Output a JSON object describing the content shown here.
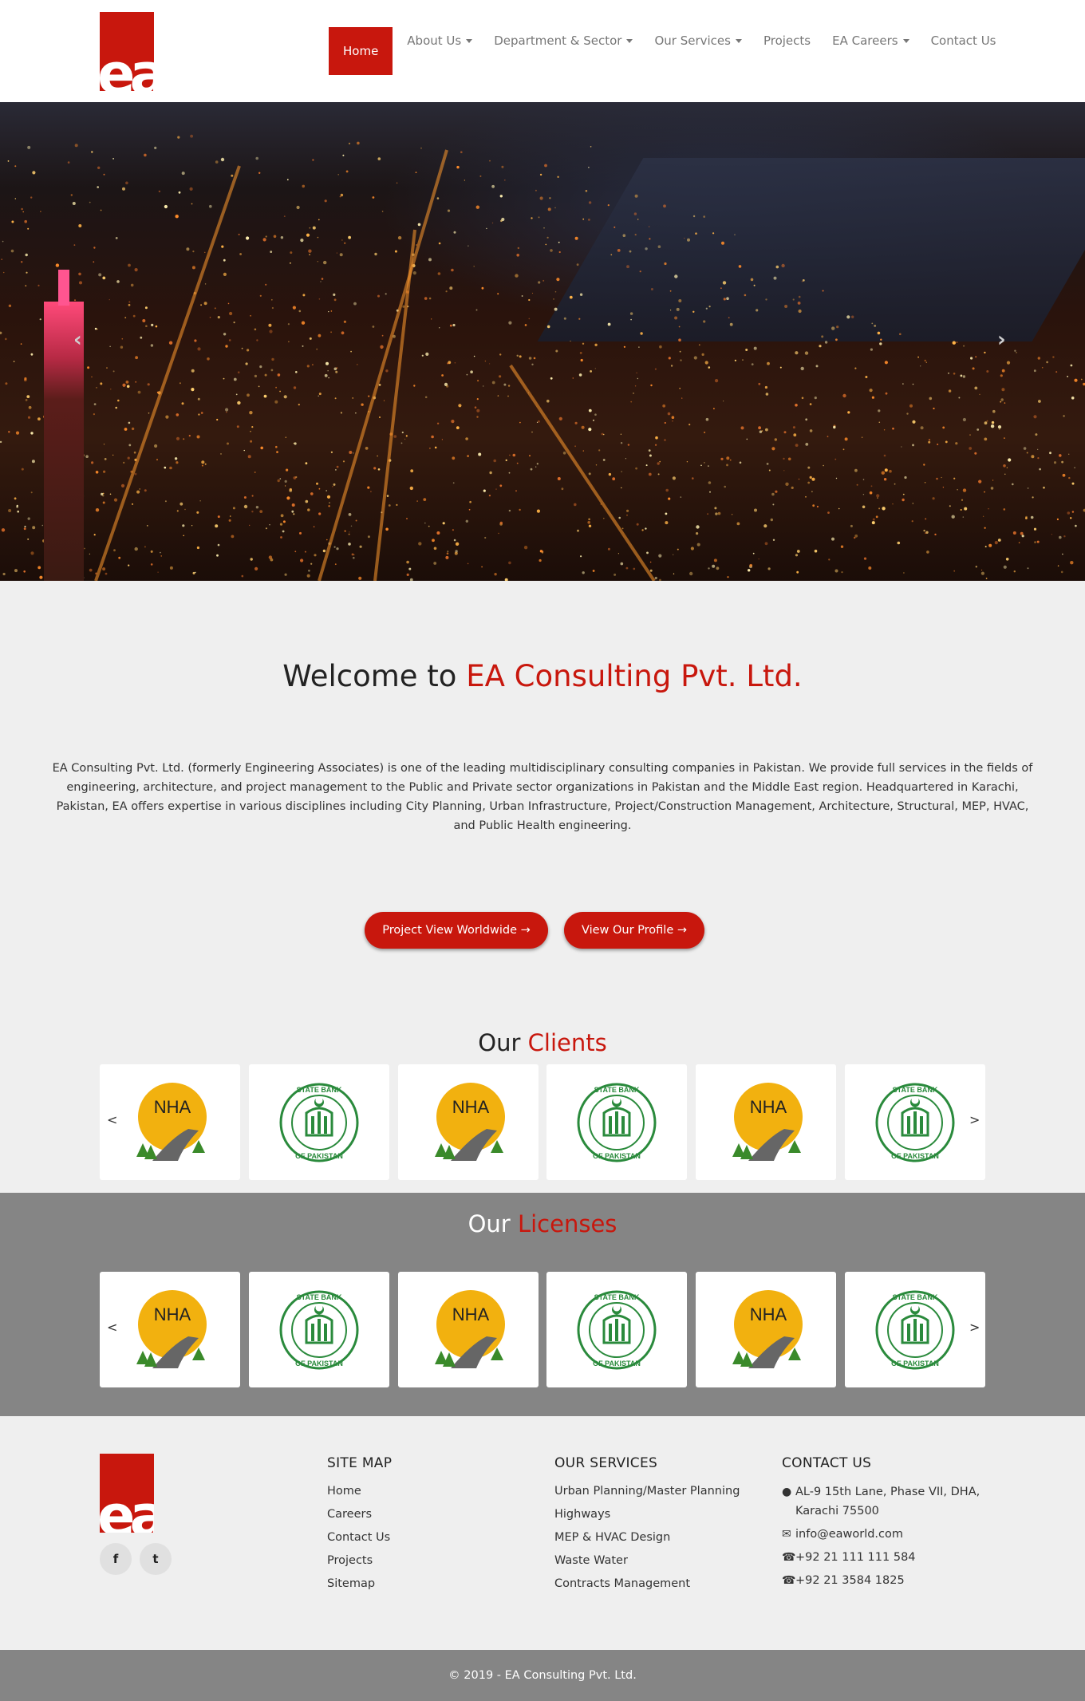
{
  "brand": {
    "logo_text": "ea",
    "color": "#c8170d"
  },
  "nav": {
    "items": [
      {
        "label": "Home",
        "active": true,
        "dropdown": false
      },
      {
        "label": "About Us",
        "dropdown": true
      },
      {
        "label": "Department & Sector",
        "dropdown": true
      },
      {
        "label": "Our Services",
        "dropdown": true
      },
      {
        "label": "Projects",
        "dropdown": false
      },
      {
        "label": "EA Careers",
        "dropdown": true
      },
      {
        "label": "Contact Us",
        "dropdown": false
      }
    ]
  },
  "hero": {
    "prev_label": "‹",
    "next_label": "›"
  },
  "welcome": {
    "title_prefix": "Welcome to ",
    "title_highlight": "EA Consulting Pvt. Ltd.",
    "text": "EA Consulting Pvt. Ltd. (formerly Engineering Associates) is one of the leading multidisciplinary consulting companies in Pakistan. We provide full services in the fields of engineering, architecture, and project management to the Public and Private sector organizations in Pakistan and the Middle East region. Headquartered in Karachi, Pakistan, EA offers expertise in various disciplines including City Planning, Urban Infrastructure, Project/Construction Management, Architecture, Structural, MEP, HVAC, and Public Health engineering.",
    "btn_projects": "Project View Worldwide →",
    "btn_profile": "View Our Profile →"
  },
  "clients": {
    "title_prefix": "Our ",
    "title_highlight": "Clients",
    "prev": "<",
    "next": ">",
    "logos": [
      "NHA",
      "State Bank of Pakistan",
      "NHA",
      "State Bank of Pakistan",
      "NHA",
      "State Bank of Pakistan"
    ]
  },
  "licenses": {
    "title_prefix": "Our ",
    "title_highlight": "Licenses",
    "prev": "<",
    "next": ">",
    "logos": [
      "NHA",
      "State Bank of Pakistan",
      "NHA",
      "State Bank of Pakistan",
      "NHA",
      "State Bank of Pakistan"
    ]
  },
  "logo_text": {
    "nha": "NHA",
    "sbp_top": "STATE BANK",
    "sbp_bottom": "OF PAKISTAN"
  },
  "footer": {
    "social": {
      "facebook": "f",
      "twitter": "t"
    },
    "sitemap": {
      "heading": "SITE MAP",
      "links": [
        "Home",
        "Careers",
        "Contact Us",
        "Projects",
        "Sitemap"
      ]
    },
    "services": {
      "heading": "OUR SERVICES",
      "links": [
        "Urban Planning/Master Planning",
        "Highways",
        "MEP & HVAC Design",
        "Waste Water",
        "Contracts Management"
      ]
    },
    "contact": {
      "heading": "CONTACT US",
      "address": "AL-9 15th Lane, Phase VII, DHA, Karachi 75500",
      "email": "info@eaworld.com",
      "phone1": "+92 21 111 111 584",
      "phone2": "+92 21 3584 1825"
    },
    "copyright": "© 2019 - EA Consulting Pvt. Ltd."
  }
}
